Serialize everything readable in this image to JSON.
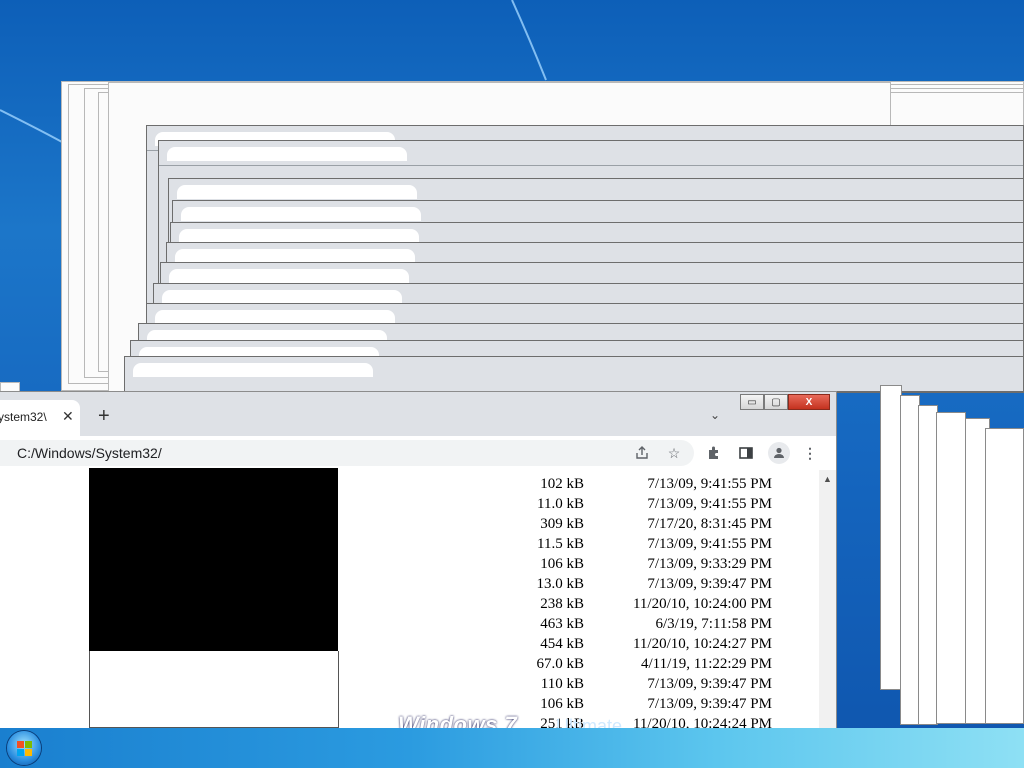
{
  "desktop": {
    "background_color": "#1566bf",
    "edition_text": {
      "brand": "Windows 7",
      "edition": "Ultimate"
    }
  },
  "browser": {
    "tab": {
      "title": "ystem32\\",
      "close_icon": "close-icon"
    },
    "new_tab_label": "+",
    "tab_search_icon": "chevron-down-icon",
    "window_controls": {
      "minimize": "▭",
      "maximize": "▢",
      "close": "X"
    },
    "address_bar": {
      "value": "C:/Windows/System32/"
    },
    "toolbar_icons": [
      "share-icon",
      "star-icon",
      "extensions-icon",
      "side-panel-icon",
      "profile-icon",
      "menu-icon"
    ]
  },
  "file_listing": {
    "rows": [
      {
        "size": "102 kB",
        "date": "7/13/09, 9:41:55 PM"
      },
      {
        "size": "11.0 kB",
        "date": "7/13/09, 9:41:55 PM"
      },
      {
        "size": "309 kB",
        "date": "7/17/20, 8:31:45 PM"
      },
      {
        "size": "11.5 kB",
        "date": "7/13/09, 9:41:55 PM"
      },
      {
        "size": "106 kB",
        "date": "7/13/09, 9:33:29 PM"
      },
      {
        "size": "13.0 kB",
        "date": "7/13/09, 9:39:47 PM"
      },
      {
        "size": "238 kB",
        "date": "11/20/10, 10:24:00 PM"
      },
      {
        "size": "463 kB",
        "date": "6/3/19, 7:11:58 PM"
      },
      {
        "size": "454 kB",
        "date": "11/20/10, 10:24:27 PM"
      },
      {
        "size": "67.0 kB",
        "date": "4/11/19, 11:22:29 PM"
      },
      {
        "size": "110 kB",
        "date": "7/13/09, 9:39:47 PM"
      },
      {
        "size": "106 kB",
        "date": "7/13/09, 9:39:47 PM"
      },
      {
        "size": "251 kB",
        "date": "11/20/10, 10:24:24 PM"
      }
    ]
  }
}
